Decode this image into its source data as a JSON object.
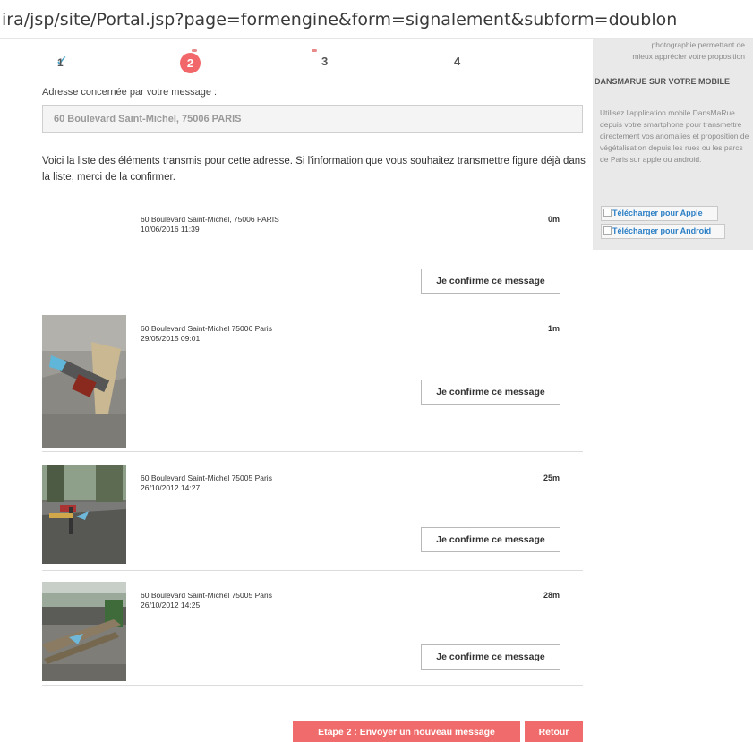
{
  "url": "ira/jsp/site/Portal.jsp?page=formengine&form=signalement&subform=doublon",
  "steps": {
    "step1": "1",
    "step2": "2",
    "step3": "3",
    "step4": "4"
  },
  "address": {
    "label": "Adresse concernée par votre message :",
    "value": "60 Boulevard Saint-Michel, 75006 PARIS"
  },
  "intro": "Voici la liste des éléments transmis pour cette adresse. Si l'information que vous souhaitez transmettre figure déjà dans la liste, merci de la confirmer.",
  "items": [
    {
      "address": "60 Boulevard Saint-Michel, 75006 PARIS",
      "date": "10/06/2016 11:39",
      "distance": "0m",
      "confirm": "Je confirme ce message"
    },
    {
      "address": "60 Boulevard Saint-Michel 75006 Paris",
      "date": "29/05/2015 09:01",
      "distance": "1m",
      "confirm": "Je confirme ce message"
    },
    {
      "address": "60 Boulevard Saint-Michel 75005 Paris",
      "date": "26/10/2012 14:27",
      "distance": "25m",
      "confirm": "Je confirme ce message"
    },
    {
      "address": "60 Boulevard Saint-Michel 75005 Paris",
      "date": "26/10/2012 14:25",
      "distance": "28m",
      "confirm": "Je confirme ce message"
    }
  ],
  "buttons": {
    "new_message": "Etape 2 : Envoyer un nouveau message",
    "back": "Retour"
  },
  "sidebar": {
    "top_text_1": "photographie permettant de",
    "top_text_2": "mieux apprécier votre proposition",
    "title": "DANSMARUE SUR VOTRE MOBILE",
    "text": "Utilisez l'application mobile DansMaRue depuis votre smartphone pour transmettre directement vos anomalies et proposition de végétalisation depuis les rues ou les parcs de Paris sur apple ou android.",
    "link_apple": "Télécharger pour Apple",
    "link_android": "Télécharger pour Android"
  },
  "colors": {
    "accent_red": "#f06b6b",
    "check_blue": "#4aa3c8",
    "link_blue": "#2b7fc6"
  }
}
